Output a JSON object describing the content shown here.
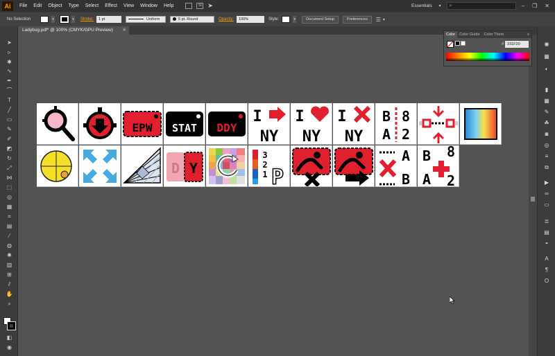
{
  "app": {
    "logo": "Ai",
    "menu": [
      "File",
      "Edit",
      "Object",
      "Type",
      "Select",
      "Effect",
      "View",
      "Window",
      "Help"
    ],
    "menubar_icons": [
      "bridge-icon",
      "stock-icon",
      "share-icon"
    ],
    "menubar_icon_text": "St",
    "workspace": "Essentials",
    "window_buttons": [
      "–",
      "❐",
      "✕"
    ]
  },
  "control": {
    "selection": "No Selection",
    "stroke_label": "Stroke:",
    "stroke_weight": "1 pt",
    "profile": "Uniform",
    "brush": "5 pt. Round",
    "opacity_label": "Opacity:",
    "opacity": "100%",
    "style_label": "Style:",
    "document_setup": "Document Setup",
    "preferences": "Preferences"
  },
  "document": {
    "tab": "Ladybug.pdf* @ 100% (CMYK/GPU Preview)",
    "close": "✕"
  },
  "color_panel": {
    "tabs": [
      "Color",
      "Color Guide",
      "Color Them"
    ],
    "hash": "#",
    "hex": "231F20",
    "colors": {
      "fill": "#ffffff",
      "stroke": "#000000"
    }
  },
  "tiles_row1": [
    {
      "kind": "magnifier-pink",
      "name": "tile-magnifier-icon"
    },
    {
      "kind": "target-arrow",
      "name": "tile-target-arrow-icon"
    },
    {
      "kind": "ticket",
      "text": "EPW",
      "color": "#e0202f",
      "name": "tile-epw-ticket"
    },
    {
      "kind": "ticket",
      "text": "STAT",
      "color": "#000000",
      "name": "tile-stat-ticket"
    },
    {
      "kind": "ticket",
      "text": "DDY",
      "color": "#000000",
      "text_color": "#e0202f",
      "name": "tile-ddy-ticket"
    },
    {
      "kind": "i-ny",
      "symbol": "arrow",
      "top": "I",
      "bottom": "NY",
      "name": "tile-i-arrow-ny"
    },
    {
      "kind": "i-ny",
      "symbol": "heart",
      "top": "I",
      "bottom": "NY",
      "name": "tile-i-heart-ny"
    },
    {
      "kind": "i-ny",
      "symbol": "x",
      "top": "I",
      "bottom": "NY",
      "name": "tile-i-x-ny"
    },
    {
      "kind": "ba82",
      "letters": [
        "B",
        "8",
        "A",
        "2"
      ],
      "name": "tile-ba82-dashed"
    },
    {
      "kind": "arrows-squares",
      "name": "tile-arrows-squares-icon"
    },
    {
      "kind": "gradient",
      "name": "tile-gradient-swatch"
    }
  ],
  "tiles_row2": [
    {
      "kind": "yellow-circle",
      "name": "tile-yellow-circle-icon"
    },
    {
      "kind": "arrows-in",
      "name": "tile-arrows-in-icon"
    },
    {
      "kind": "perspective",
      "name": "tile-perspective-grid-icon"
    },
    {
      "kind": "dy-ticket",
      "letters": [
        "D",
        "Y"
      ],
      "name": "tile-dy-ticket"
    },
    {
      "kind": "color-grid",
      "name": "tile-color-grid-icon"
    },
    {
      "kind": "numbers-p",
      "numbers": [
        "3",
        "2",
        "1"
      ],
      "letter": "P",
      "name": "tile-numbers-p-icon"
    },
    {
      "kind": "red-x-figure",
      "name": "tile-red-x-figure"
    },
    {
      "kind": "red-arrow-figure",
      "name": "tile-red-arrow-figure"
    },
    {
      "kind": "xab",
      "letters": [
        "A",
        "B"
      ],
      "name": "tile-x-ab-icon"
    },
    {
      "kind": "ba-plus",
      "letters": [
        "B",
        "8",
        "A",
        "2"
      ],
      "name": "tile-ba-plus-icon"
    }
  ]
}
